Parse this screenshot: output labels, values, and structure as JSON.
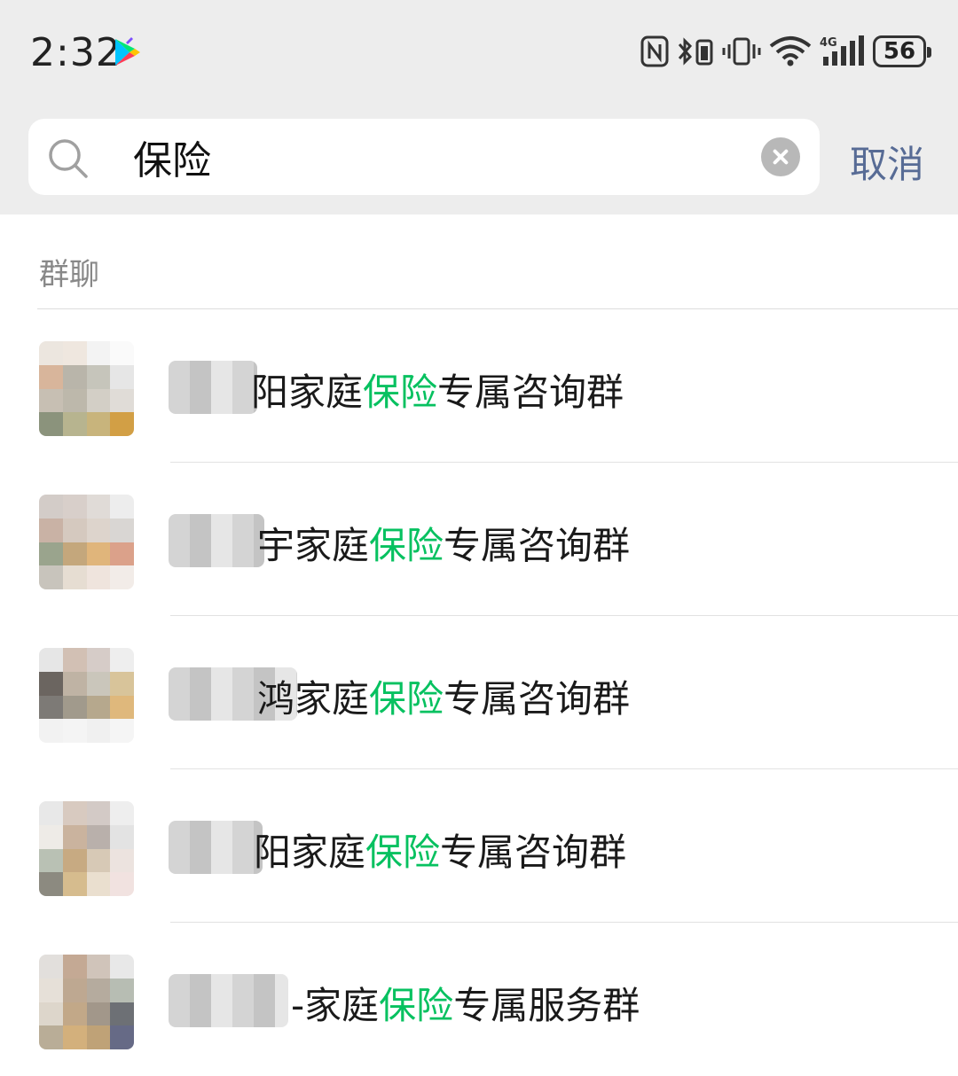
{
  "status_bar": {
    "time": "2:32",
    "battery": "56",
    "network": "4G"
  },
  "search": {
    "query": "保险",
    "cancel_label": "取消"
  },
  "section_title": "群聊",
  "results": [
    {
      "prefix": "阳",
      "before": "家庭",
      "highlight": "保险",
      "after": "专属咨询群"
    },
    {
      "prefix": "宇",
      "before": "家庭",
      "highlight": "保险",
      "after": "专属咨询群"
    },
    {
      "prefix": "鸿",
      "before": "家庭",
      "highlight": "保险",
      "after": "专属咨询群"
    },
    {
      "prefix": "阳",
      "before": "家庭",
      "highlight": "保险",
      "after": "专属咨询群"
    },
    {
      "prefix": "-",
      "before": "家庭",
      "highlight": "保险",
      "after": "专属服务群"
    }
  ],
  "colors": {
    "highlight": "#07c160",
    "cancel": "#576b95",
    "header_bg": "#ededed"
  }
}
